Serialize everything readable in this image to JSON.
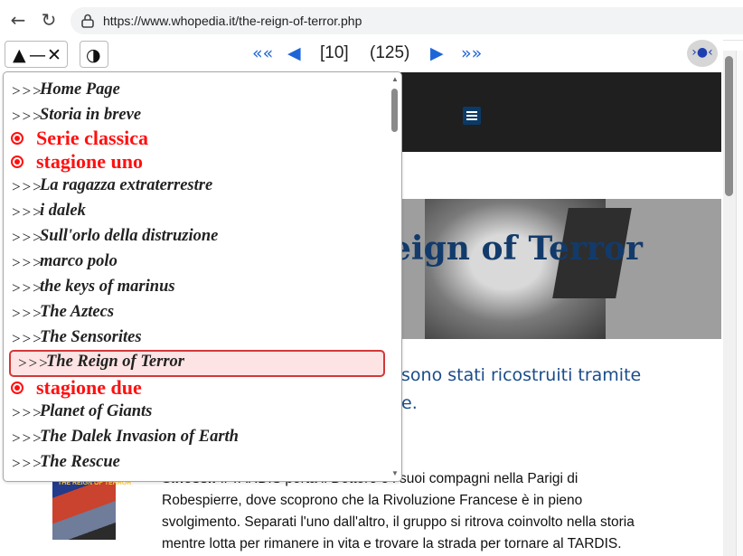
{
  "browser": {
    "url": "https://www.whopedia.it/the-reign-of-terror.php",
    "back_glyph": "←",
    "reload_glyph": "↻"
  },
  "toolbar": {
    "zoom_symbols": [
      "▲",
      "—",
      "✕"
    ],
    "contrast_glyph": "◑",
    "first_glyph": "««",
    "prev_glyph": "◀",
    "current_page": "[10]",
    "total_pages": "(125)",
    "next_glyph": "▶",
    "last_glyph": "»»",
    "eye_glyph": "›●‹"
  },
  "menu": {
    "items": [
      {
        "arrow": ">>>",
        "label": "Home Page",
        "kind": "link"
      },
      {
        "arrow": ">>>",
        "label": "Storia in breve",
        "kind": "link"
      },
      {
        "arrow": "",
        "label": "Serie classica",
        "kind": "header"
      },
      {
        "arrow": "",
        "label": "stagione uno",
        "kind": "header"
      },
      {
        "arrow": ">>>",
        "label": "La ragazza extraterrestre",
        "kind": "link"
      },
      {
        "arrow": ">>>",
        "label": "i dalek",
        "kind": "link"
      },
      {
        "arrow": ">>>",
        "label": "Sull'orlo della distruzione",
        "kind": "link"
      },
      {
        "arrow": ">>>",
        "label": "marco polo",
        "kind": "link"
      },
      {
        "arrow": ">>>",
        "label": "the keys of marinus",
        "kind": "link"
      },
      {
        "arrow": ">>>",
        "label": "The Aztecs",
        "kind": "link"
      },
      {
        "arrow": ">>>",
        "label": "The Sensorites",
        "kind": "link"
      },
      {
        "arrow": ">>>",
        "label": "The Reign of Terror",
        "kind": "active"
      },
      {
        "arrow": "",
        "label": "stagione due",
        "kind": "header"
      },
      {
        "arrow": ">>>",
        "label": "Planet of Giants",
        "kind": "link"
      },
      {
        "arrow": ">>>",
        "label": "The Dalek Invasion of Earth",
        "kind": "link"
      },
      {
        "arrow": ">>>",
        "label": "The Rescue",
        "kind": "link"
      }
    ],
    "scroll_up_glyph": "▲",
    "scroll_down_glyph": "▼"
  },
  "page": {
    "hero_title": "eign of Terror",
    "lead_line1": "sono stati ricostruiti tramite",
    "lead_line2": "e.",
    "book_title": "THE REIGN OF TERROR",
    "synopsis_label": "Sinossi:",
    "synopsis_line1": "Il TARDIS porta il Dottore e i suoi compagni nella Parigi di",
    "synopsis_line2": "Robespierre, dove scoprono che la Rivoluzione Francese è in pieno",
    "synopsis_line3": "svolgimento. Separati l'uno dall'altro, il gruppo si ritrova coinvolto nella storia",
    "synopsis_line4": "mentre lotta per rimanere in vita e trovare la strada per tornare al TARDIS."
  },
  "colors": {
    "accent_blue": "#1e66d8",
    "menu_header_red": "#ff1010",
    "active_bg": "#fde3e3",
    "active_border": "#d23838",
    "title_navy": "#123b6b"
  }
}
